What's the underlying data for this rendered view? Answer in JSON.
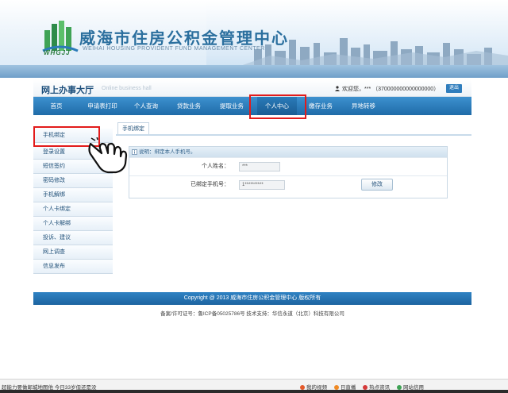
{
  "header": {
    "site_title": "威海市住房公积金管理中心",
    "site_subtitle": "WEIHAI HOUSING PROVIDENT FUND MANAGEMENT CENTER",
    "logo_text": "WHGJJ"
  },
  "hall": {
    "title": "网上办事大厅",
    "subtitle_en": "Online business hall",
    "welcome": "欢迎您，*** （370000000000000000）",
    "logout_label": "退出"
  },
  "nav": {
    "items": [
      {
        "label": "首页"
      },
      {
        "label": "申请表打印"
      },
      {
        "label": "个人查询"
      },
      {
        "label": "贷款业务"
      },
      {
        "label": "提取业务"
      },
      {
        "label": "个人中心"
      },
      {
        "label": "缴存业务"
      },
      {
        "label": "异地转移"
      }
    ],
    "active_index": 5
  },
  "sidebar": {
    "items": [
      {
        "label": "手机绑定"
      },
      {
        "label": "登录设置"
      },
      {
        "label": "短信签约"
      },
      {
        "label": "密码修改"
      },
      {
        "label": "手机解绑"
      },
      {
        "label": "个人卡绑定"
      },
      {
        "label": "个人卡解绑"
      },
      {
        "label": "投诉、建议"
      },
      {
        "label": "网上调查"
      },
      {
        "label": "信息发布"
      }
    ],
    "active_index": 0
  },
  "content": {
    "tab_label": "手机绑定",
    "panel_note": "说明：绑定本人手机号。",
    "name_label": "个人姓名：",
    "name_value": "***",
    "phone_label": "已绑定手机号：",
    "phone_value": "1**********",
    "modify_button": "修改"
  },
  "footer": {
    "copyright": "Copyright @ 2013 威海市住房公积金管理中心 版权所有",
    "record": "备案/许可证号：鲁ICP备05025786号  技术支持：华信永道（北京）科技有限公司"
  },
  "statusbar": {
    "left_text": "超能力要做邮城地图他  今日33岁但还是没",
    "items": [
      {
        "label": "我的视频"
      },
      {
        "label": "日直播"
      },
      {
        "label": "热点资讯"
      },
      {
        "label": "网站信用"
      }
    ]
  },
  "colors": {
    "nav_blue": "#1f6ba8",
    "highlight_red": "#e21b1b",
    "title_blue": "#2b6f9e"
  }
}
